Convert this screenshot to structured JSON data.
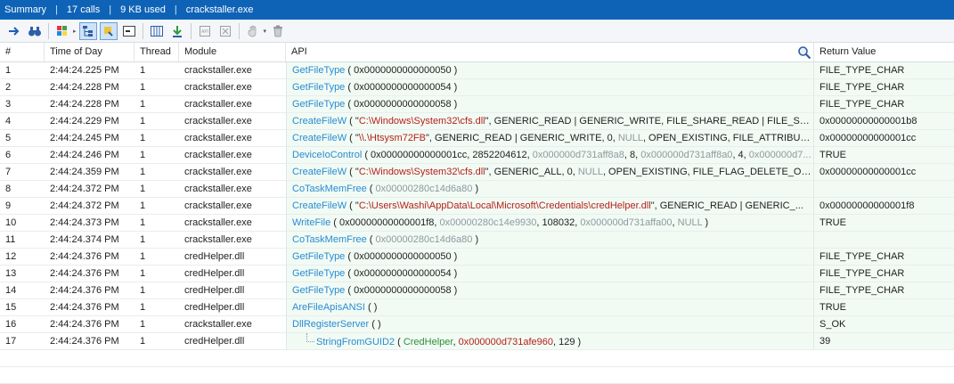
{
  "summary": {
    "title": "Summary",
    "calls": "17 calls",
    "used": "9 KB used",
    "process": "crackstaller.exe",
    "separator": "|"
  },
  "toolbar": {
    "buttons": [
      "arrow-right-icon",
      "binoculars-icon",
      "color-grid-icon",
      "tree-view-icon",
      "highlight-icon",
      "console-icon",
      "columns-icon",
      "export-down-icon",
      "api-doc-icon",
      "api-delete-icon",
      "hand-icon",
      "trash-icon"
    ]
  },
  "columns": {
    "num": "#",
    "time": "Time of Day",
    "thread": "Thread",
    "module": "Module",
    "api": "API",
    "ret": "Return Value"
  },
  "rows": [
    {
      "num": "1",
      "time": "2:44:24.225 PM",
      "thread": "1",
      "module": "crackstaller.exe",
      "ret": "FILE_TYPE_CHAR",
      "api": [
        [
          "fn",
          "GetFileType"
        ],
        [
          "pl",
          " ( 0x0000000000000050 )"
        ]
      ]
    },
    {
      "num": "2",
      "time": "2:44:24.228 PM",
      "thread": "1",
      "module": "crackstaller.exe",
      "ret": "FILE_TYPE_CHAR",
      "api": [
        [
          "fn",
          "GetFileType"
        ],
        [
          "pl",
          " ( 0x0000000000000054 )"
        ]
      ]
    },
    {
      "num": "3",
      "time": "2:44:24.228 PM",
      "thread": "1",
      "module": "crackstaller.exe",
      "ret": "FILE_TYPE_CHAR",
      "api": [
        [
          "fn",
          "GetFileType"
        ],
        [
          "pl",
          " ( 0x0000000000000058 )"
        ]
      ]
    },
    {
      "num": "4",
      "time": "2:44:24.229 PM",
      "thread": "1",
      "module": "crackstaller.exe",
      "ret": "0x00000000000001b8",
      "api": [
        [
          "fn",
          "CreateFileW"
        ],
        [
          "pl",
          " ( \""
        ],
        [
          "str",
          "C:\\Windows\\System32\\cfs.dll"
        ],
        [
          "pl",
          "\", GENERIC_READ | GENERIC_WRITE, FILE_SHARE_READ | FILE_SHARE..."
        ]
      ]
    },
    {
      "num": "5",
      "time": "2:44:24.245 PM",
      "thread": "1",
      "module": "crackstaller.exe",
      "ret": "0x00000000000001cc",
      "api": [
        [
          "fn",
          "CreateFileW"
        ],
        [
          "pl",
          " ( \""
        ],
        [
          "str",
          "\\\\.\\Htsysm72FB"
        ],
        [
          "pl",
          "\", GENERIC_READ | GENERIC_WRITE, 0, "
        ],
        [
          "hex",
          "NULL"
        ],
        [
          "pl",
          ", OPEN_EXISTING, FILE_ATTRIBUTE_NO..."
        ]
      ]
    },
    {
      "num": "6",
      "time": "2:44:24.246 PM",
      "thread": "1",
      "module": "crackstaller.exe",
      "ret": "TRUE",
      "api": [
        [
          "fn",
          "DeviceIoControl"
        ],
        [
          "pl",
          " ( 0x00000000000001cc, 2852204612, "
        ],
        [
          "hex",
          "0x000000d731aff8a8"
        ],
        [
          "pl",
          ", 8, "
        ],
        [
          "hex",
          "0x000000d731aff8a0"
        ],
        [
          "pl",
          ", 4, "
        ],
        [
          "hex",
          "0x000000d7..."
        ]
      ]
    },
    {
      "num": "7",
      "time": "2:44:24.359 PM",
      "thread": "1",
      "module": "crackstaller.exe",
      "ret": "0x00000000000001cc",
      "api": [
        [
          "fn",
          "CreateFileW"
        ],
        [
          "pl",
          " ( \""
        ],
        [
          "str",
          "C:\\Windows\\System32\\cfs.dll"
        ],
        [
          "pl",
          "\", GENERIC_ALL, 0, "
        ],
        [
          "hex",
          "NULL"
        ],
        [
          "pl",
          ", OPEN_EXISTING, FILE_FLAG_DELETE_ON_CL..."
        ]
      ]
    },
    {
      "num": "8",
      "time": "2:44:24.372 PM",
      "thread": "1",
      "module": "crackstaller.exe",
      "ret": "",
      "api": [
        [
          "fn",
          "CoTaskMemFree"
        ],
        [
          "pl",
          " ( "
        ],
        [
          "hex",
          "0x00000280c14d6a80"
        ],
        [
          "pl",
          " )"
        ]
      ]
    },
    {
      "num": "9",
      "time": "2:44:24.372 PM",
      "thread": "1",
      "module": "crackstaller.exe",
      "ret": "0x00000000000001f8",
      "api": [
        [
          "fn",
          "CreateFileW"
        ],
        [
          "pl",
          " ( \""
        ],
        [
          "str",
          "C:\\Users\\Washi\\AppData\\Local\\Microsoft\\Credentials\\credHelper.dll"
        ],
        [
          "pl",
          "\", GENERIC_READ | GENERIC_..."
        ]
      ]
    },
    {
      "num": "10",
      "time": "2:44:24.373 PM",
      "thread": "1",
      "module": "crackstaller.exe",
      "ret": "TRUE",
      "api": [
        [
          "fn",
          "WriteFile"
        ],
        [
          "pl",
          " ( 0x00000000000001f8, "
        ],
        [
          "hex",
          "0x00000280c14e9930"
        ],
        [
          "pl",
          ", 108032, "
        ],
        [
          "hex",
          "0x000000d731affa00"
        ],
        [
          "pl",
          ", "
        ],
        [
          "hex",
          "NULL"
        ],
        [
          "pl",
          " )"
        ]
      ]
    },
    {
      "num": "11",
      "time": "2:44:24.374 PM",
      "thread": "1",
      "module": "crackstaller.exe",
      "ret": "",
      "api": [
        [
          "fn",
          "CoTaskMemFree"
        ],
        [
          "pl",
          " ( "
        ],
        [
          "hex",
          "0x00000280c14d6a80"
        ],
        [
          "pl",
          " )"
        ]
      ]
    },
    {
      "num": "12",
      "time": "2:44:24.376 PM",
      "thread": "1",
      "module": "credHelper.dll",
      "ret": "FILE_TYPE_CHAR",
      "api": [
        [
          "fn",
          "GetFileType"
        ],
        [
          "pl",
          " ( 0x0000000000000050 )"
        ]
      ]
    },
    {
      "num": "13",
      "time": "2:44:24.376 PM",
      "thread": "1",
      "module": "credHelper.dll",
      "ret": "FILE_TYPE_CHAR",
      "api": [
        [
          "fn",
          "GetFileType"
        ],
        [
          "pl",
          " ( 0x0000000000000054 )"
        ]
      ]
    },
    {
      "num": "14",
      "time": "2:44:24.376 PM",
      "thread": "1",
      "module": "credHelper.dll",
      "ret": "FILE_TYPE_CHAR",
      "api": [
        [
          "fn",
          "GetFileType"
        ],
        [
          "pl",
          " ( 0x0000000000000058 )"
        ]
      ]
    },
    {
      "num": "15",
      "time": "2:44:24.376 PM",
      "thread": "1",
      "module": "credHelper.dll",
      "ret": "TRUE",
      "api": [
        [
          "fn",
          "AreFileApisANSI"
        ],
        [
          "pl",
          " (  )"
        ]
      ]
    },
    {
      "num": "16",
      "time": "2:44:24.376 PM",
      "thread": "1",
      "module": "crackstaller.exe",
      "ret": "S_OK",
      "api": [
        [
          "fn",
          "DllRegisterServer"
        ],
        [
          "pl",
          " (  )"
        ]
      ]
    },
    {
      "num": "17",
      "time": "2:44:24.376 PM",
      "thread": "1",
      "module": "credHelper.dll",
      "ret": "39",
      "child": true,
      "api": [
        [
          "fn",
          "StringFromGUID2"
        ],
        [
          "pl",
          " ( "
        ],
        [
          "grn",
          "CredHelper"
        ],
        [
          "pl",
          ", "
        ],
        [
          "str",
          "0x000000d731afe960"
        ],
        [
          "pl",
          ", 129 )"
        ]
      ]
    }
  ]
}
